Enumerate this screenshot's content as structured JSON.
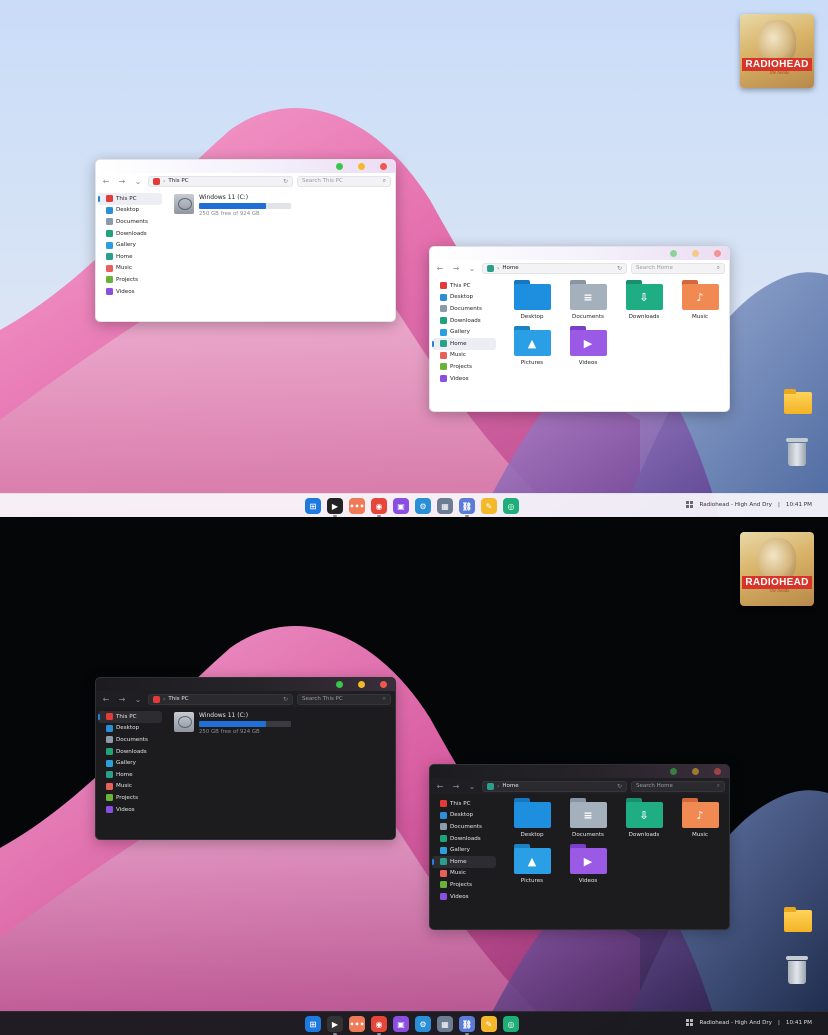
{
  "album": {
    "band": "RADIOHEAD",
    "subtitle": "the bends"
  },
  "taskbar": {
    "now_playing": "Radiohead - High And Dry",
    "separator": "|",
    "time": "10:41 PM",
    "apps": [
      {
        "name": "windows-start",
        "color": "#1f7ae0",
        "glyph": "⊞"
      },
      {
        "name": "media-player",
        "color": "#222222",
        "glyph": "▶"
      },
      {
        "name": "app-launcher",
        "color": "#f07a56",
        "glyph": "•••"
      },
      {
        "name": "browser",
        "color": "#e6463a",
        "glyph": "◉"
      },
      {
        "name": "video",
        "color": "#8a4fe0",
        "glyph": "▣"
      },
      {
        "name": "steam",
        "color": "#2a8fd6",
        "glyph": "⚙"
      },
      {
        "name": "calculator",
        "color": "#6b7c93",
        "glyph": "▦"
      },
      {
        "name": "link",
        "color": "#5a7bd6",
        "glyph": "⛓"
      },
      {
        "name": "notes",
        "color": "#f4b92a",
        "glyph": "✎"
      },
      {
        "name": "android",
        "color": "#1fae78",
        "glyph": "◎"
      }
    ]
  },
  "sidebar_items": [
    {
      "label": "This PC",
      "color": "#e33a3a"
    },
    {
      "label": "Desktop",
      "color": "#2a8fd6"
    },
    {
      "label": "Documents",
      "color": "#8c9aaa"
    },
    {
      "label": "Downloads",
      "color": "#1fa37a"
    },
    {
      "label": "Gallery",
      "color": "#2a9fe0"
    },
    {
      "label": "Home",
      "color": "#2aa08a"
    },
    {
      "label": "Music",
      "color": "#e8605a"
    },
    {
      "label": "Projects",
      "color": "#6ab23a"
    },
    {
      "label": "Videos",
      "color": "#8a4fe0"
    }
  ],
  "thispc_window": {
    "address": "This PC",
    "search_placeholder": "Search This PC",
    "drive": {
      "name": "Windows 11 (C:)",
      "free_text": "250 GB free of 924 GB",
      "used_fraction": 0.73
    }
  },
  "home_window": {
    "address": "Home",
    "search_placeholder": "Search Home",
    "folders": [
      {
        "label": "Desktop",
        "color": "#1d8fde",
        "tab": "#1577bf",
        "glyph": ""
      },
      {
        "label": "Documents",
        "color": "#a5b0bd",
        "tab": "#8894a3",
        "glyph": "≡"
      },
      {
        "label": "Downloads",
        "color": "#1fae84",
        "tab": "#17906d",
        "glyph": "⇩"
      },
      {
        "label": "Music",
        "color": "#f08a52",
        "tab": "#d5663d",
        "glyph": "♪"
      },
      {
        "label": "Pictures",
        "color": "#2a9fe6",
        "tab": "#1d82c4",
        "glyph": "▲"
      },
      {
        "label": "Videos",
        "color": "#9a5ae6",
        "tab": "#7a3fc9",
        "glyph": "▶"
      }
    ]
  },
  "colors": {
    "accent": "#1f6fd6"
  }
}
